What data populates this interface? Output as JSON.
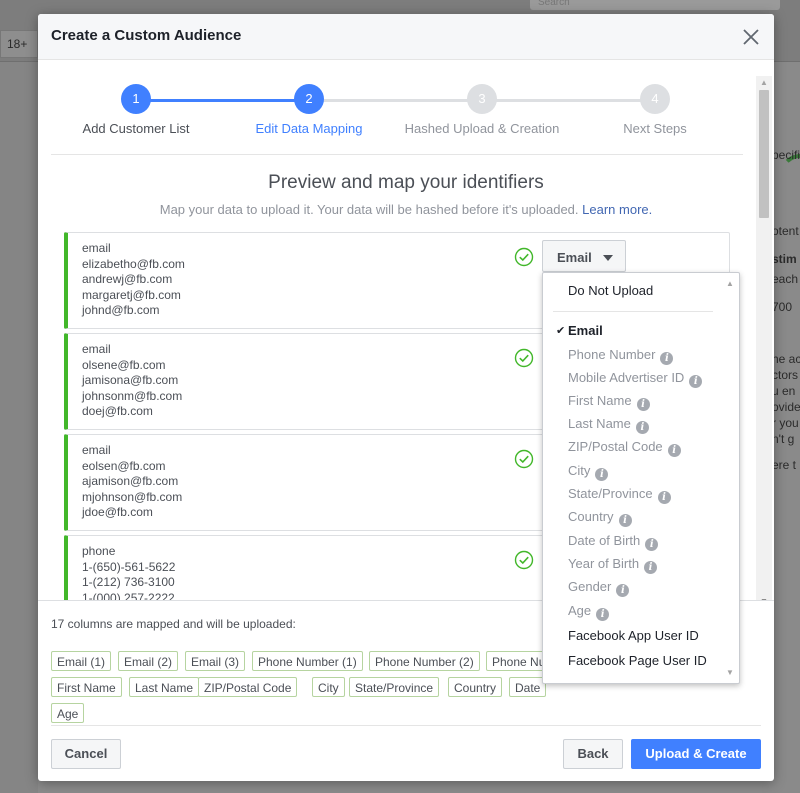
{
  "background": {
    "age_label": "18+",
    "search_placeholder": "Search",
    "right_fragments": [
      "pecific",
      "otent",
      "stim",
      "each",
      "700",
      "he ac",
      "ctors",
      "u en",
      "ovide",
      "r you",
      "n't g",
      "ere t"
    ]
  },
  "modal": {
    "title": "Create a Custom Audience",
    "close_icon": "close-icon"
  },
  "stepper": {
    "steps": [
      {
        "number": "1",
        "label": "Add Customer List",
        "state": "done"
      },
      {
        "number": "2",
        "label": "Edit Data Mapping",
        "state": "current"
      },
      {
        "number": "3",
        "label": "Hashed Upload & Creation",
        "state": "todo"
      },
      {
        "number": "4",
        "label": "Next Steps",
        "state": "todo"
      }
    ]
  },
  "preview": {
    "title": "Preview and map your identifiers",
    "subtitle": "Map your data to upload it. Your data will be hashed before it's uploaded.",
    "learn_more": "Learn more."
  },
  "columns": [
    {
      "header": "email",
      "values": [
        "elizabetho@fb.com",
        "andrewj@fb.com",
        "margaretj@fb.com",
        "johnd@fb.com"
      ],
      "mapping": "Email"
    },
    {
      "header": "email",
      "values": [
        "olsene@fb.com",
        "jamisona@fb.com",
        "johnsonm@fb.com",
        "doej@fb.com"
      ],
      "mapping": ""
    },
    {
      "header": "email",
      "values": [
        "eolsen@fb.com",
        "ajamison@fb.com",
        "mjohnson@fb.com",
        "jdoe@fb.com"
      ],
      "mapping": ""
    },
    {
      "header": "phone",
      "values": [
        "1-(650)-561-5622",
        "1-(212) 736-3100",
        "1-(000) 257-2222"
      ],
      "mapping": ""
    }
  ],
  "dropdown_menu": {
    "items": [
      {
        "label": "Do Not Upload",
        "state": "enabled",
        "info": false
      },
      {
        "label": "Email",
        "state": "selected",
        "info": false
      },
      {
        "label": "Phone Number",
        "state": "disabled",
        "info": true
      },
      {
        "label": "Mobile Advertiser ID",
        "state": "disabled",
        "info": true
      },
      {
        "label": "First Name",
        "state": "disabled",
        "info": true
      },
      {
        "label": "Last Name",
        "state": "disabled",
        "info": true
      },
      {
        "label": "ZIP/Postal Code",
        "state": "disabled",
        "info": true
      },
      {
        "label": "City",
        "state": "disabled",
        "info": true
      },
      {
        "label": "State/Province",
        "state": "disabled",
        "info": true
      },
      {
        "label": "Country",
        "state": "disabled",
        "info": true
      },
      {
        "label": "Date of Birth",
        "state": "disabled",
        "info": true
      },
      {
        "label": "Year of Birth",
        "state": "disabled",
        "info": true
      },
      {
        "label": "Gender",
        "state": "disabled",
        "info": true
      },
      {
        "label": "Age",
        "state": "disabled",
        "info": true
      },
      {
        "label": "Facebook App User ID",
        "state": "enabled",
        "info": false
      },
      {
        "label": "Facebook Page User ID",
        "state": "enabled",
        "info": false
      }
    ],
    "check_glyph": "✔"
  },
  "summary": {
    "label": "17 columns are mapped and will be uploaded:",
    "tags_row1": [
      "Email (1)",
      "Email (2)",
      "Email (3)",
      "Phone Number (1)",
      "Phone Number (2)",
      "Phone Nu"
    ],
    "tags_row2": [
      "First Name",
      "Last Name",
      "ZIP/Postal Code",
      "City",
      "State/Province",
      "Country",
      "Date"
    ],
    "tags_row3": [
      "Age"
    ]
  },
  "footer": {
    "cancel": "Cancel",
    "back": "Back",
    "primary": "Upload & Create"
  },
  "colors": {
    "accent": "#4080ff",
    "mapped_green": "#42b72a",
    "check_green": "#42b72a"
  }
}
